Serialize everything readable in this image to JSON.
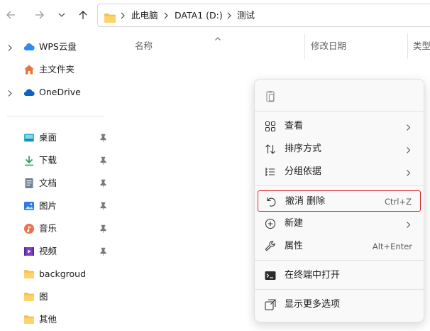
{
  "toolbar": {
    "back_icon": "arrow-left-icon",
    "forward_icon": "arrow-right-icon",
    "recent_icon": "chevron-down-icon",
    "up_icon": "arrow-up-icon"
  },
  "breadcrumb": {
    "items": [
      "此电脑",
      "DATA1 (D:)",
      "测试"
    ]
  },
  "sidebar": {
    "items": [
      {
        "label": "WPS云盘",
        "icon": "wps-cloud-icon",
        "expandable": true
      },
      {
        "label": "主文件夹",
        "icon": "home-icon",
        "expandable": false
      },
      {
        "label": "OneDrive",
        "icon": "onedrive-cloud-icon",
        "expandable": true
      },
      {
        "label": "桌面",
        "icon": "desktop-icon",
        "pinned": true
      },
      {
        "label": "下载",
        "icon": "download-icon",
        "pinned": true
      },
      {
        "label": "文档",
        "icon": "document-icon",
        "pinned": true
      },
      {
        "label": "图片",
        "icon": "pictures-icon",
        "pinned": true
      },
      {
        "label": "音乐",
        "icon": "music-icon",
        "pinned": true
      },
      {
        "label": "视频",
        "icon": "video-icon",
        "pinned": true
      },
      {
        "label": "backgroud",
        "icon": "folder-icon",
        "pinned": false
      },
      {
        "label": "图",
        "icon": "folder-icon",
        "pinned": false
      },
      {
        "label": "其他",
        "icon": "folder-icon",
        "pinned": false
      }
    ]
  },
  "filelist": {
    "columns": [
      "名称",
      "修改日期",
      "类型"
    ],
    "sorted_column": "名称"
  },
  "context_menu": {
    "top_icon": "paste-icon",
    "items": [
      {
        "label": "查看",
        "icon": "view-grid-icon",
        "submenu": true
      },
      {
        "label": "排序方式",
        "icon": "sort-icon",
        "submenu": true
      },
      {
        "label": "分组依据",
        "icon": "group-by-icon",
        "submenu": true
      },
      {
        "label": "撤消 删除",
        "icon": "undo-icon",
        "shortcut": "Ctrl+Z",
        "highlighted": true
      },
      {
        "label": "新建",
        "icon": "new-plus-icon",
        "submenu": true
      },
      {
        "label": "属性",
        "icon": "properties-wrench-icon",
        "shortcut": "Alt+Enter"
      },
      {
        "label": "在终端中打开",
        "icon": "terminal-icon"
      },
      {
        "label": "显示更多选项",
        "icon": "show-more-options-icon"
      }
    ]
  },
  "colors": {
    "highlight_border": "#d9262c",
    "folder_yellow": "#f4c152",
    "accent_blue": "#0a62c2"
  }
}
